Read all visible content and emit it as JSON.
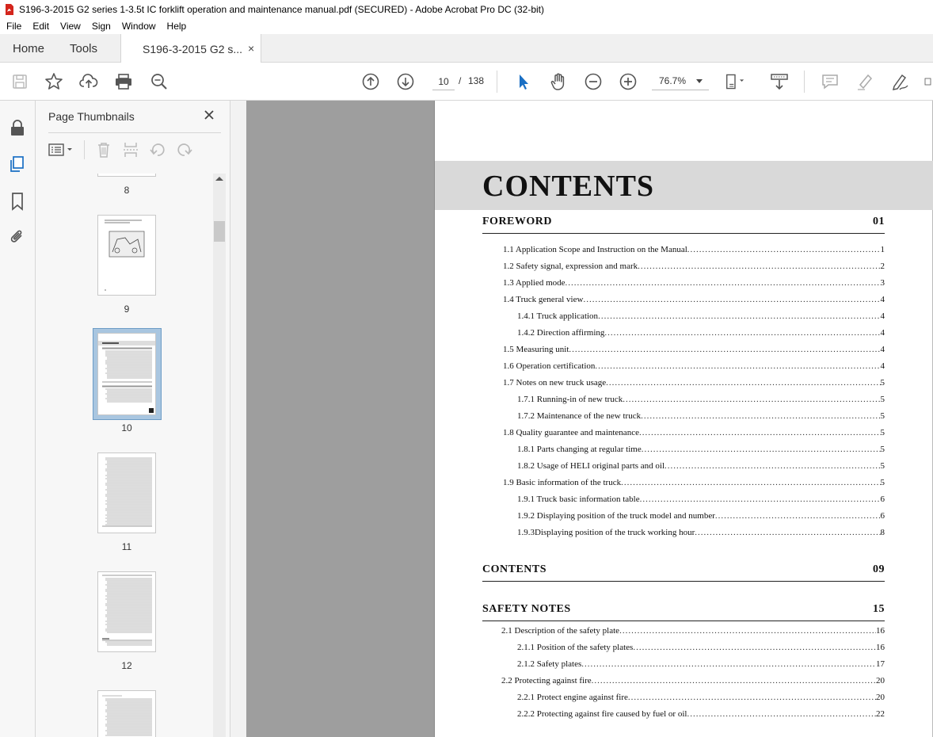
{
  "window": {
    "title": "S196-3-2015 G2 series 1-3.5t IC forklift operation and maintenance manual.pdf (SECURED) - Adobe Acrobat Pro DC (32-bit)"
  },
  "menu": [
    "File",
    "Edit",
    "View",
    "Sign",
    "Window",
    "Help"
  ],
  "tabs": {
    "home": "Home",
    "tools": "Tools",
    "doc": "S196-3-2015 G2 s...",
    "doc_close": "×"
  },
  "toolbar": {
    "page_current": "10",
    "page_sep": "/",
    "page_total": "138",
    "zoom": "76.7%",
    "icons": [
      "save-icon",
      "bookmark-star-icon",
      "upload-icon",
      "print-icon",
      "zoom-search-icon",
      "previous-page-icon",
      "next-page-icon",
      "select-cursor-icon",
      "hand-tool-icon",
      "zoom-out-icon",
      "zoom-in-icon",
      "page-fit-icon",
      "scroll-mode-icon",
      "comment-icon",
      "highlight-icon",
      "sign-icon"
    ]
  },
  "left_rail": {
    "icons": [
      "lock-icon",
      "page-thumbnails-icon",
      "bookmark-icon",
      "attachment-icon"
    ]
  },
  "thumbnails": {
    "title": "Page Thumbnails",
    "pages": [
      {
        "label": "8"
      },
      {
        "label": "9"
      },
      {
        "label": "10",
        "selected": true
      },
      {
        "label": "11"
      },
      {
        "label": "12"
      }
    ]
  },
  "document": {
    "heading": "CONTENTS",
    "sections": [
      {
        "title": "FOREWORD",
        "page": "01",
        "entries": [
          {
            "text": "1.1 Application Scope and Instruction on the Manual",
            "page": "1",
            "level": 1
          },
          {
            "text": "1.2 Safety signal, expression and mark",
            "page": "2",
            "level": 1
          },
          {
            "text": "1.3 Applied mode",
            "page": "3",
            "level": 1
          },
          {
            "text": "1.4 Truck general view",
            "page": "4",
            "level": 1
          },
          {
            "text": "1.4.1 Truck application",
            "page": "4",
            "level": 2
          },
          {
            "text": "1.4.2 Direction affirming",
            "page": "4",
            "level": 2
          },
          {
            "text": "1.5 Measuring unit",
            "page": "4",
            "level": 1
          },
          {
            "text": "1.6 Operation certification",
            "page": "4",
            "level": 1
          },
          {
            "text": "1.7 Notes on new truck usage",
            "page": "5",
            "level": 1
          },
          {
            "text": "1.7.1 Running-in of new truck",
            "page": "5",
            "level": 2
          },
          {
            "text": "1.7.2 Maintenance of the new truck",
            "page": "5",
            "level": 2
          },
          {
            "text": "1.8 Quality guarantee and maintenance",
            "page": "5",
            "level": 1
          },
          {
            "text": "1.8.1 Parts changing at regular time",
            "page": "5",
            "level": 2
          },
          {
            "text": "1.8.2 Usage of HELI original parts and oil",
            "page": "5",
            "level": 2
          },
          {
            "text": "1.9 Basic information of the truck",
            "page": "5",
            "level": 1
          },
          {
            "text": "1.9.1 Truck basic information table",
            "page": "6",
            "level": 2
          },
          {
            "text": "1.9.2 Displaying position of the truck model and number",
            "page": "6",
            "level": 2
          },
          {
            "text": "1.9.3Displaying position of the truck working hour",
            "page": "8",
            "level": 2
          }
        ]
      },
      {
        "title": "CONTENTS",
        "page": "09",
        "entries": []
      },
      {
        "title": "SAFETY NOTES",
        "page": "15",
        "entries": [
          {
            "text": "2.1 Description of the safety plate",
            "page": "16",
            "level": 1
          },
          {
            "text": "2.1.1 Position of the safety plates",
            "page": "16",
            "level": 2
          },
          {
            "text": "2.1.2 Safety plates",
            "page": "17",
            "level": 2
          },
          {
            "text": "2.2 Protecting against fire",
            "page": "20",
            "level": 1
          },
          {
            "text": "2.2.1 Protect engine against fire",
            "page": "20",
            "level": 2
          },
          {
            "text": "2.2.2 Protecting against fire caused by fuel or oil",
            "page": "22",
            "level": 2
          }
        ]
      }
    ]
  },
  "colors": {
    "accent_blue": "#1a6fc4",
    "acrobat_red": "#d4251c",
    "selected_thumb": "#a9c6e0"
  }
}
